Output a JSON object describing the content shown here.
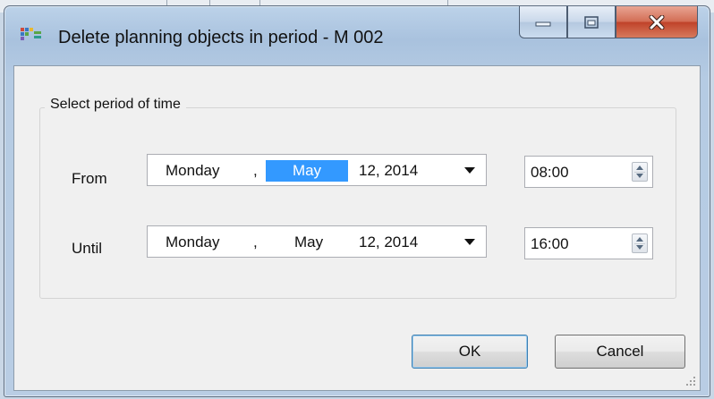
{
  "window": {
    "title": "Delete planning objects in period - M 002",
    "controls": {
      "minimize": "minimize",
      "maximize": "maximize",
      "close": "close"
    }
  },
  "group": {
    "label": "Select period of time"
  },
  "from": {
    "label": "From",
    "weekday": "Monday",
    "sep": ",",
    "month": "May",
    "day_year": "12, 2014",
    "time": "08:00"
  },
  "until": {
    "label": "Until",
    "weekday": "Monday",
    "sep": ",",
    "month": "May",
    "day_year": "12, 2014",
    "time": "16:00"
  },
  "buttons": {
    "ok": "OK",
    "cancel": "Cancel"
  },
  "colors": {
    "selection": "#3399ff",
    "close_button": "#c0432a",
    "dialog_bg": "#f0f0f0",
    "title_bar": "#bcd2e9"
  },
  "icons": {
    "app": "planning-app-icon",
    "minimize": "minimize-icon",
    "maximize": "maximize-icon",
    "close": "close-icon",
    "dropdown": "chevron-down-icon",
    "spinner": "spin-updown-icon",
    "grip": "resize-grip-icon"
  }
}
